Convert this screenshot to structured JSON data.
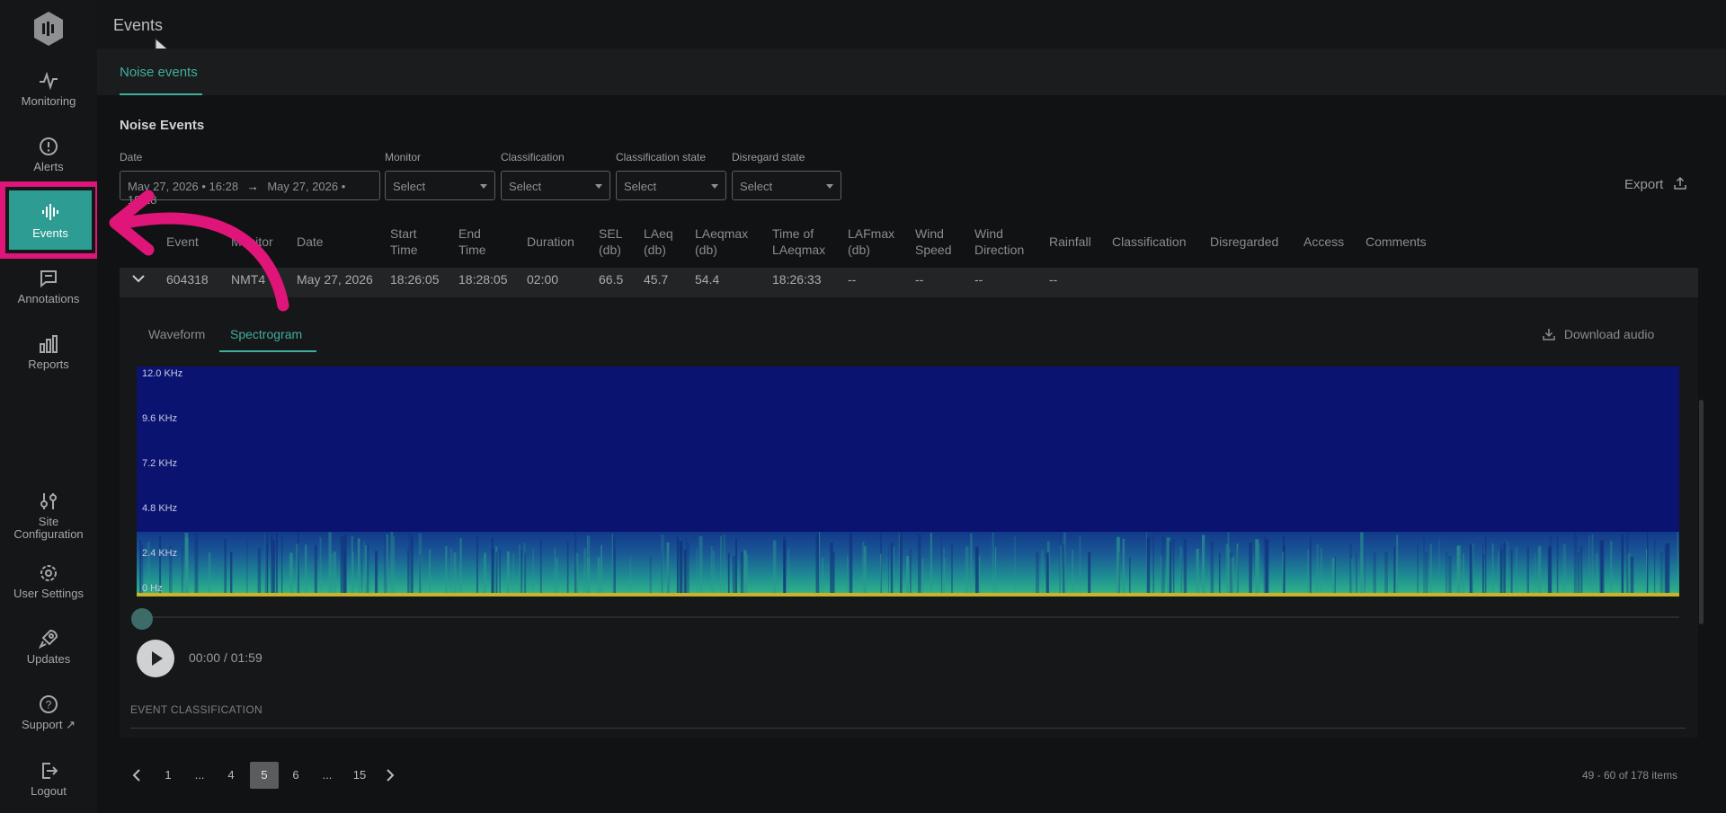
{
  "header": {
    "title": "Events",
    "subtab": "Noise events"
  },
  "sidebar": {
    "items": [
      {
        "label": "Monitoring",
        "icon": "pulse-icon"
      },
      {
        "label": "Alerts",
        "icon": "alert-circle-icon"
      },
      {
        "label": "Events",
        "icon": "soundwave-icon",
        "active": true
      },
      {
        "label": "Annotations",
        "icon": "comment-icon"
      },
      {
        "label": "Reports",
        "icon": "bar-chart-icon"
      },
      {
        "label": "Site Configuration",
        "icon": "sliders-icon"
      },
      {
        "label": "User Settings",
        "icon": "gear-icon"
      },
      {
        "label": "Updates",
        "icon": "rocket-icon"
      },
      {
        "label": "Support",
        "icon": "help-circle-icon"
      },
      {
        "label": "Logout",
        "icon": "logout-icon"
      }
    ]
  },
  "section": {
    "title": "Noise Events"
  },
  "filters": {
    "date_label": "Date",
    "date_value_start": "May 27, 2026 • 16:28",
    "date_arrow": "→",
    "date_value_end": "May 27, 2026 • 19:28",
    "monitor_label": "Monitor",
    "classification_label": "Classification",
    "classification_state_label": "Classification state",
    "disregard_state_label": "Disregard state",
    "select_placeholder": "Select",
    "export_label": "Export"
  },
  "table": {
    "headers": [
      "Event",
      "Monitor",
      "Date",
      "Start Time",
      "End Time",
      "Duration",
      "SEL (db)",
      "LAeq (db)",
      "LAeqmax (db)",
      "Time of LAeqmax",
      "LAFmax (db)",
      "Wind Speed",
      "Wind Direction",
      "Rainfall",
      "Classification",
      "Disregarded",
      "Access",
      "Comments"
    ],
    "row": {
      "event": "604318",
      "monitor": "NMT4",
      "date": "May 27, 2026",
      "start": "18:26:05",
      "end": "18:28:05",
      "duration": "02:00",
      "sel": "66.5",
      "laeq": "45.7",
      "laeqmax": "54.4",
      "time_laeqmax": "18:26:33",
      "lafmax": "--",
      "wind_speed": "--",
      "wind_direction": "--",
      "rainfall": "--"
    }
  },
  "detail": {
    "tab_waveform": "Waveform",
    "tab_spectrogram": "Spectrogram",
    "download": "Download audio",
    "freq_labels": [
      "12.0 KHz",
      "9.6 KHz",
      "7.2 KHz",
      "4.8 KHz",
      "2.4 KHz",
      "0  Hz"
    ],
    "timecode": "00:00 / 01:59",
    "playback_progress": 0,
    "event_classification": "EVENT CLASSIFICATION"
  },
  "pagination": {
    "pages": [
      "1",
      "...",
      "4",
      "5",
      "6",
      "...",
      "15"
    ],
    "active": "5",
    "items_text": "49 - 60 of 178 items"
  },
  "colors": {
    "accent": "#3fae9f",
    "highlight": "#e0157a",
    "spectrogram_bg": "#0a1470"
  }
}
